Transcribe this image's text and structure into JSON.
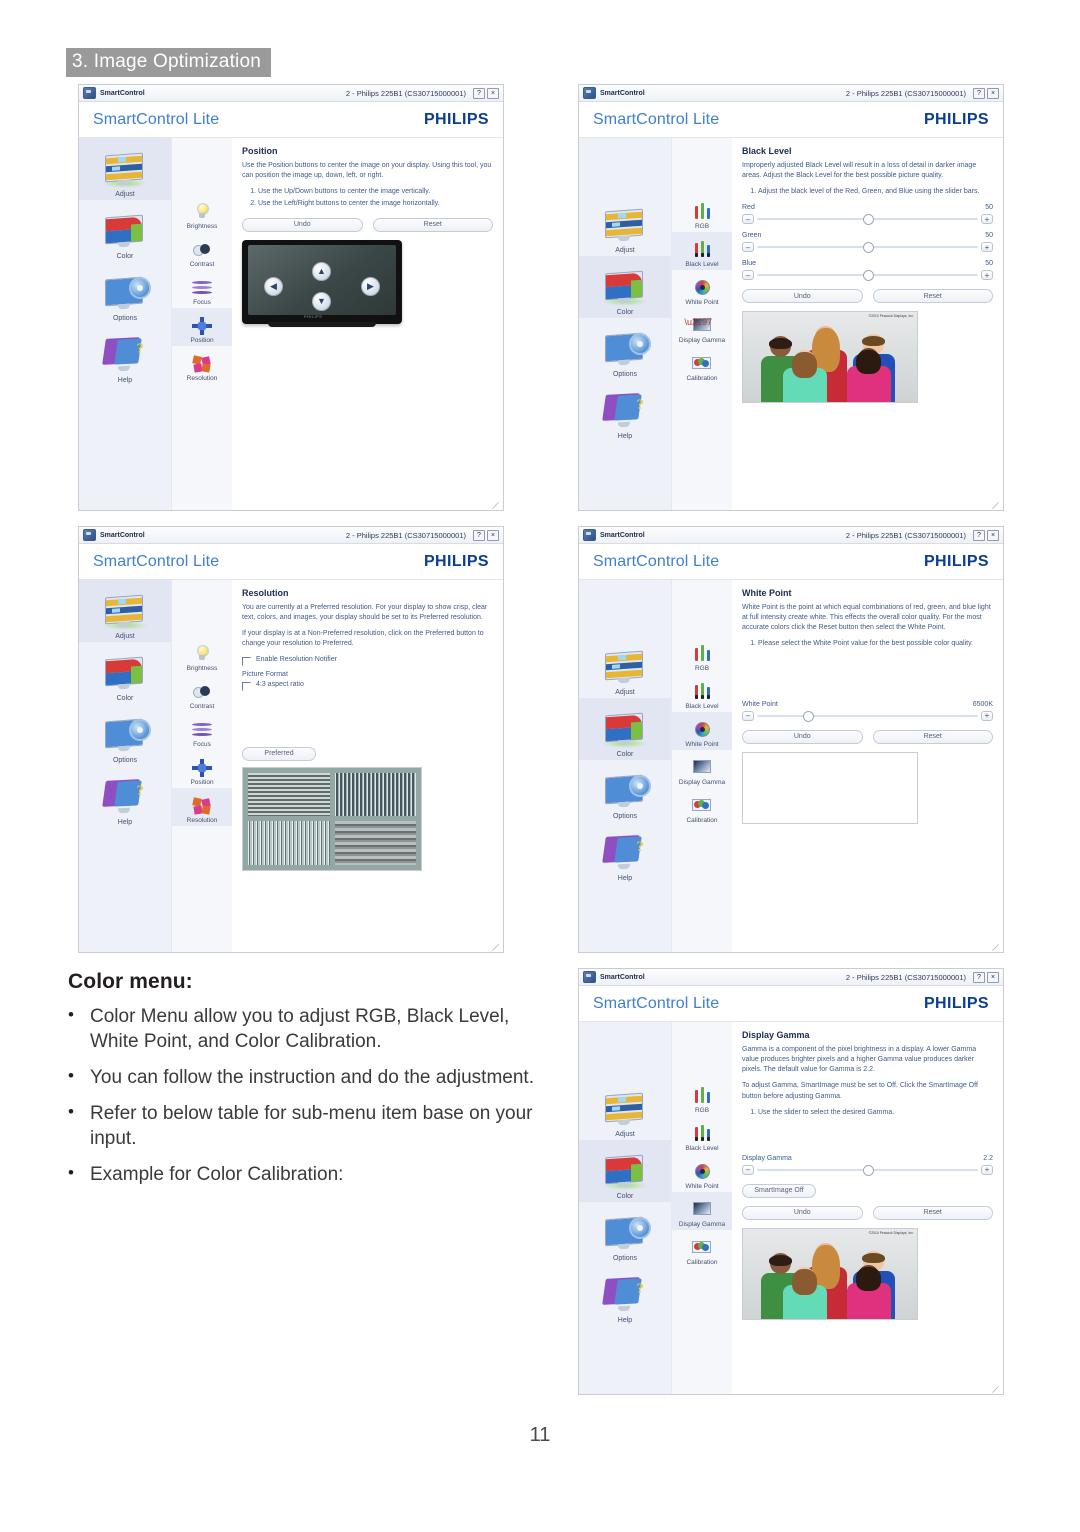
{
  "document": {
    "chapter_header": "3. Image Optimization",
    "page_number": "11"
  },
  "window_chrome": {
    "app_name": "SmartControl",
    "title": "2 - Philips 225B1 (CS30715000001)",
    "help_button": "?",
    "close_button": "×",
    "brand_left": "SmartControl Lite",
    "brand_right": "PHILIPS"
  },
  "main_menu": [
    {
      "label": "Adjust",
      "icon": "adjust-monitor-icon"
    },
    {
      "label": "Color",
      "icon": "color-monitor-icon"
    },
    {
      "label": "Options",
      "icon": "options-gear-icon"
    },
    {
      "label": "Help",
      "icon": "help-question-icon"
    }
  ],
  "adjust_submenu": [
    {
      "label": "Brightness",
      "icon": "brightness-bulb-icon"
    },
    {
      "label": "Contrast",
      "icon": "contrast-circles-icon"
    },
    {
      "label": "Focus",
      "icon": "focus-waves-icon"
    },
    {
      "label": "Position",
      "icon": "position-arrows-icon"
    },
    {
      "label": "Resolution",
      "icon": "resolution-pinwheel-icon"
    }
  ],
  "color_submenu": [
    {
      "label": "RGB",
      "icon": "rgb-bars-icon"
    },
    {
      "label": "Black Level",
      "icon": "black-level-bars-icon"
    },
    {
      "label": "White Point",
      "icon": "white-point-wheel-icon"
    },
    {
      "label": "Display Gamma",
      "icon": "display-gamma-screen-icon"
    },
    {
      "label": "Calibration",
      "icon": "calibration-circles-icon"
    }
  ],
  "buttons": {
    "undo": "Undo",
    "reset": "Reset",
    "preferred": "Preferred",
    "smartimage_off": "SmartImage Off"
  },
  "panel_position": {
    "title": "Position",
    "paragraph": "Use the Position buttons to center the image on your display. Using this tool, you can position the image up, down, left, or right.",
    "steps": [
      "Use the Up/Down buttons to center the image vertically.",
      "Use the Left/Right buttons to center the image horizontally."
    ],
    "monitor_logo": "PHILIPS",
    "dpad": {
      "up": "▲",
      "down": "▼",
      "left": "◀",
      "right": "▶"
    }
  },
  "panel_black_level": {
    "title": "Black Level",
    "paragraph": "Improperly adjusted Black Level will result in a loss of detail in darker image areas. Adjust the Black Level for the best possible picture quality.",
    "steps": [
      "Adjust the black level of the Red, Green, and Blue using the slider bars."
    ],
    "sliders": [
      {
        "label": "Red",
        "value": "50",
        "percent": 50
      },
      {
        "label": "Green",
        "value": "50",
        "percent": 50
      },
      {
        "label": "Blue",
        "value": "50",
        "percent": 50
      }
    ],
    "photo_credit": "©2010 Peacock Displays, Inc."
  },
  "panel_resolution": {
    "title": "Resolution",
    "paragraph1": "You are currently at a Preferred resolution. For your display to show crisp, clear text, colors, and images, your display should be set to its Preferred resolution.",
    "paragraph2": "If your display is at a Non-Preferred resolution, click on the Preferred button to change your resolution to Preferred.",
    "checkbox_notifier": "Enable Resolution Notifier",
    "picture_format_label": "Picture Format",
    "checkbox_aspect": "4:3 aspect ratio"
  },
  "panel_white_point": {
    "title": "White Point",
    "paragraph": "White Point is the point at which equal combinations of red, green, and blue light at full intensity create white. This effects the overall color quality. For the most accurate colors click the Reset button then select the White Point.",
    "steps": [
      "Please select the White Point value for the best possible color quality."
    ],
    "slider": {
      "label": "White Point",
      "value": "6500K",
      "percent": 22
    }
  },
  "panel_display_gamma": {
    "title": "Display Gamma",
    "paragraph1": "Gamma is a component of the pixel brightness in a display. A lower Gamma value produces brighter pixels and a higher Gamma value produces darker pixels. The default value for Gamma is 2.2.",
    "paragraph2": "To adjust Gamma, SmartImage must be set to Off. Click the SmartImage Off button before adjusting Gamma.",
    "steps": [
      "Use the slider to select the desired Gamma."
    ],
    "slider": {
      "label": "Display Gamma",
      "value": "2.2",
      "percent": 50
    },
    "photo_credit": "©2010 Peacock Displays, Inc."
  },
  "body_copy": {
    "heading": "Color menu:",
    "bullet_char": "•",
    "bullets": [
      "Color Menu allow you to adjust RGB, Black Level, White Point, and Color Calibration.",
      "You can follow the instruction and do the adjustment.",
      "Refer to below table for sub-menu item base on your input.",
      "Example for Color Calibration:"
    ]
  },
  "colors": {
    "brand_blue": "#0b3d91",
    "accent_blue": "#3f7fd0",
    "selected_row": "#e2e6f3",
    "header_gray": "#9a9a9a"
  }
}
